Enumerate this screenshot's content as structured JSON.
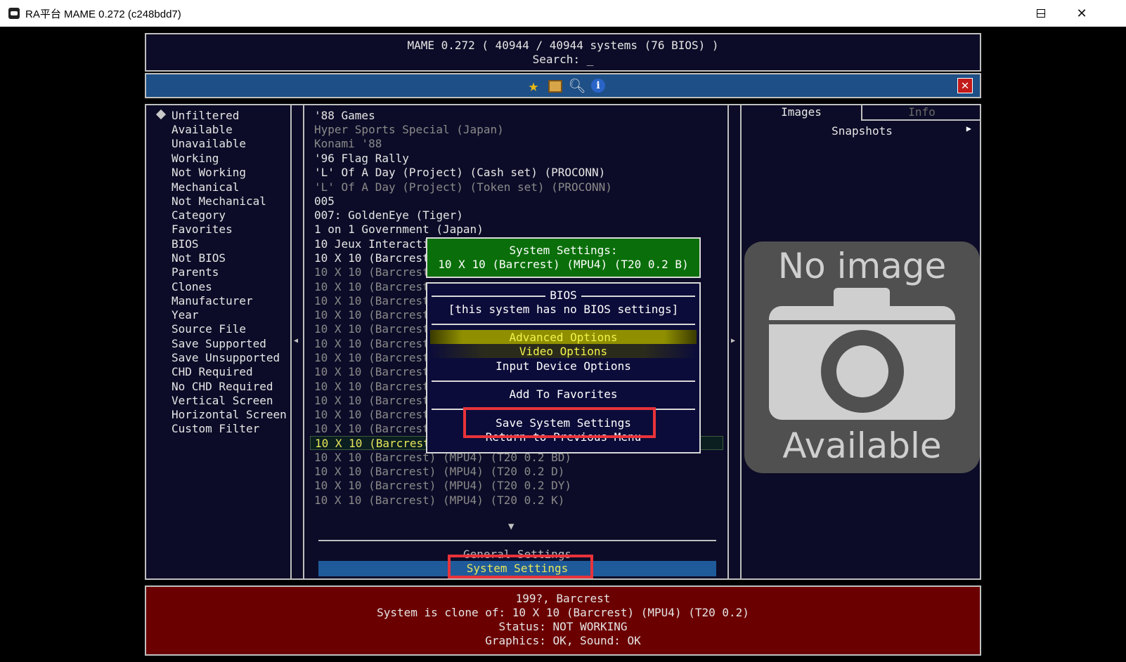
{
  "window": {
    "title": "RA平台 MAME 0.272 (c248bdd7)",
    "minimize": "—",
    "maximize": "☐",
    "close": "✕"
  },
  "header": {
    "line1": "MAME 0.272 ( 40944 / 40944 systems (76 BIOS) )",
    "line2": "Search: _"
  },
  "toolbar": {
    "icons": [
      "star-icon",
      "film-icon",
      "magnifier-icon",
      "info-icon"
    ],
    "close": "✕"
  },
  "filters": {
    "items": [
      "Unfiltered",
      "Available",
      "Unavailable",
      "Working",
      "Not Working",
      "Mechanical",
      "Not Mechanical",
      "Category",
      "Favorites",
      "BIOS",
      "Not BIOS",
      "Parents",
      "Clones",
      "Manufacturer",
      "Year",
      "Source File",
      "Save Supported",
      "Save Unsupported",
      "CHD Required",
      "No CHD Required",
      "Vertical Screen",
      "Horizontal Screen",
      "Custom Filter"
    ]
  },
  "list": {
    "rows": [
      "'88 Games",
      "Hyper Sports Special (Japan)",
      "Konami '88",
      "'96 Flag Rally",
      "'L' Of A Day (Project) (Cash set) (PROCONN)",
      "'L' Of A Day (Project) (Token set) (PROCONN)",
      "005",
      "007: GoldenEye (Tiger)",
      "1 on 1 Government (Japan)",
      "10 Jeux Interactifs / Jeux Pour",
      "10 X 10 (Barcrest",
      "10 X 10 (Barcrest) (MPU4) (T20 0.2 AD)",
      "10 X 10 (Barcrest",
      "10 X 10 (Barcrest",
      "10 X 10 (Barcrest",
      "10 X 10 (Barcrest",
      "10 X 10 (Barcrest",
      "10 X 10 (Barcrest",
      "10 X 10 (Barcrest",
      "10 X 10 (Barcrest",
      "10 X 10 (Barcrest",
      "10 X 10 (Barcrest",
      "10 X 10 (Barcrest",
      "10 X 10 (Barcrest) (MPU4) (T20 0.2 B)",
      "10 X 10 (Barcrest) (MPU4) (T20 0.2 BD)",
      "10 X 10 (Barcrest) (MPU4) (T20 0.2 D)",
      "10 X 10 (Barcrest) (MPU4) (T20 0.2 DY)",
      "10 X 10 (Barcrest) (MPU4) (T20 0.2 K)"
    ],
    "general_settings": "General Settings",
    "system_settings": "System Settings"
  },
  "right": {
    "tab_images": "Images",
    "tab_info": "Info",
    "snapshots": "Snapshots",
    "no_image_top": "No image",
    "no_image_bottom": "Available"
  },
  "status": {
    "line1": "199?, Barcrest",
    "line2": "System is clone of: 10 X 10 (Barcrest) (MPU4) (T20 0.2)",
    "line3": "Status: NOT WORKING",
    "line4": "Graphics: OK, Sound: OK"
  },
  "popup": {
    "title1": "System Settings:",
    "title2": "10 X 10 (Barcrest) (MPU4) (T20 0.2 B)",
    "bios_header": "BIOS",
    "bios_note": "[this system has no BIOS settings]",
    "advanced": "Advanced Options",
    "video": "Video Options",
    "input": "Input Device Options",
    "favorites": "Add To Favorites",
    "save": "Save System Settings",
    "return": "Return to Previous Menu"
  },
  "colors": {
    "accent_blue": "#1f5a9a",
    "status_red": "#6b0000",
    "popup_green": "#0a6f0a",
    "highlight_yellow": "#f3f34a",
    "annotation_red": "#e8333a"
  }
}
